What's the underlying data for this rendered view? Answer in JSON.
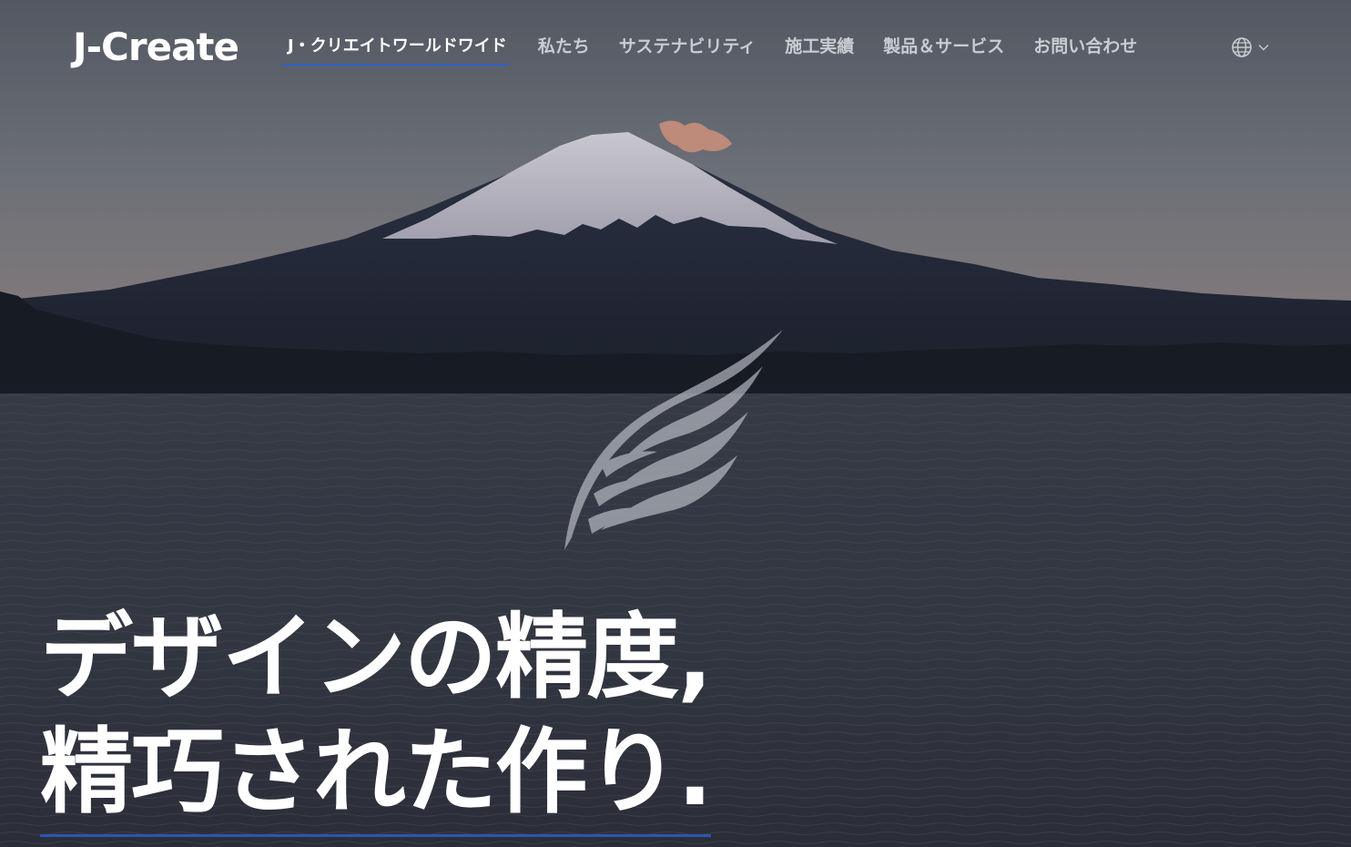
{
  "brand": {
    "logo_text": "J-Create"
  },
  "nav": {
    "items": [
      {
        "label": "J・クリエイトワールドワイド",
        "active": true
      },
      {
        "label": "私たち"
      },
      {
        "label": "サステナビリティ"
      },
      {
        "label": "施工実績"
      },
      {
        "label": "製品＆サービス"
      },
      {
        "label": "お問い合わせ"
      }
    ],
    "language_icon": "globe-icon",
    "language_chevron_icon": "chevron-down-icon"
  },
  "hero": {
    "background": "mount-fuji-lake-dusk",
    "emblem_icon": "wing-emblem-icon",
    "headline_line1": "デザインの精度,",
    "headline_line2": "精巧された作り."
  },
  "colors": {
    "accent_underline": "#2b62c9",
    "nav_text": "#c9ccd2",
    "active_text": "#ffffff"
  }
}
